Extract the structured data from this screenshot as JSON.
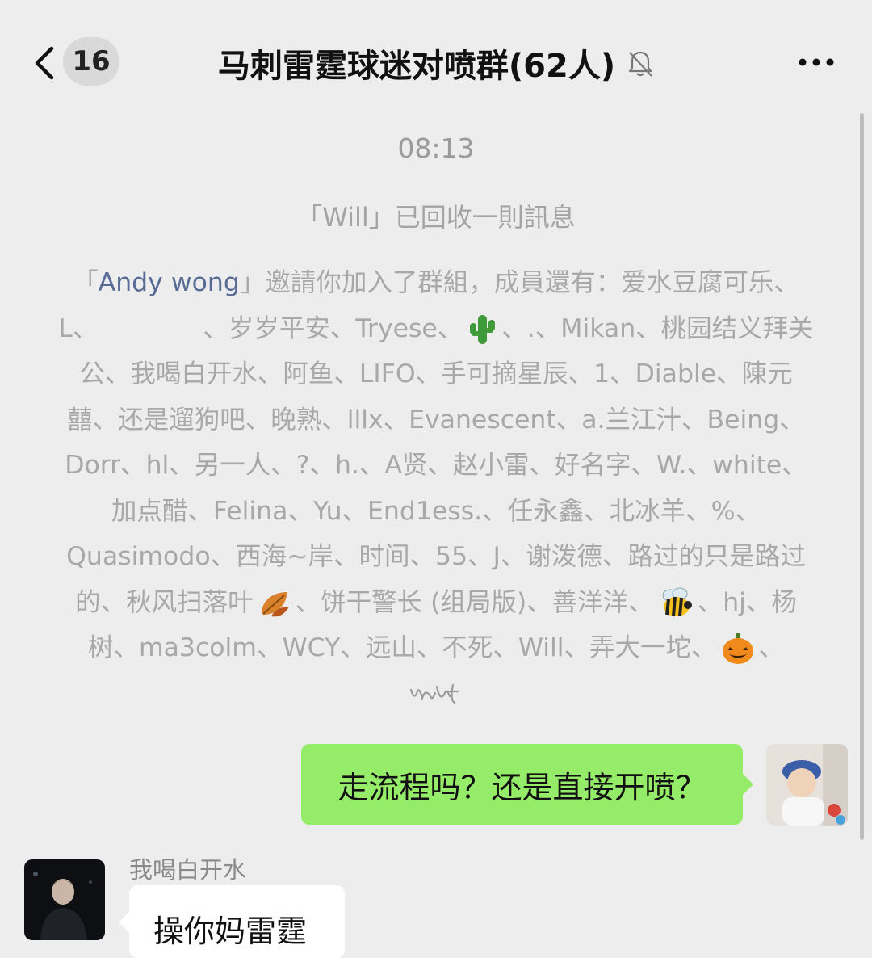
{
  "header": {
    "unread_count": "16",
    "title": "马刺雷霆球迷对喷群(62人)"
  },
  "system": {
    "timestamp": "08:13",
    "recall_notice": "「Will」已回收一則訊息",
    "invite": {
      "open_quote": "「",
      "inviter": "Andy wong",
      "seg1": "」邀請你加入了群組，成員還有：爱水豆腐可乐、L、",
      "seg2": "、岁岁平安、Tryese、",
      "seg3": "、.、Mikan、桃园结义拜关公、我喝白开水、阿鱼、LIFO、手可摘星辰、1、Diable、陳元囍、还是遛狗吧、晚熟、lllx、Evanescent、a.兰江汁、Being、Dorr、hl、另一人、?、h.、A贤、赵小雷、好名字、W.、white、加点醋、Felina、Yu、End1ess.、任永鑫、北冰羊、%、Quasimodo、西海~岸、时间、55、J、谢泼德、路过的只是路过的、秋风扫落叶",
      "seg4": "、饼干警长 (组局版)、善洋洋、",
      "seg5": "、hj、杨树、ma3colm、WCY、远山、不死、Will、弄大一坨、",
      "seg6": "、"
    }
  },
  "messages": {
    "outgoing_text": "走流程吗？还是直接开喷？",
    "incoming_sender": "我喝白开水",
    "incoming_text": "操你妈雷霆"
  },
  "icons": {
    "back": "chevron-left-icon",
    "mute": "bell-muted-icon",
    "more": "ellipsis-icon",
    "emoji_cactus": "cactus-emoji",
    "emoji_leaf": "fallen-leaf-emoji",
    "emoji_bee": "bee-emoji",
    "emoji_pumpkin": "pumpkin-emoji"
  },
  "colors": {
    "background": "#ededed",
    "outgoing_bubble": "#95ec69",
    "incoming_bubble": "#ffffff",
    "link": "#576b95"
  }
}
